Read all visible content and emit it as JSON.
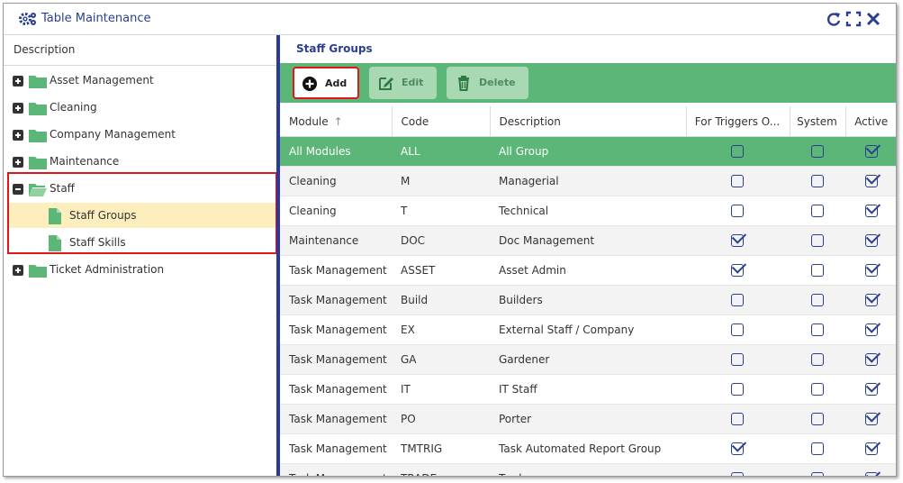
{
  "window": {
    "title": "Table Maintenance"
  },
  "tree": {
    "header": "Description",
    "items": [
      {
        "label": "Asset Management",
        "expanded": false
      },
      {
        "label": "Cleaning",
        "expanded": false
      },
      {
        "label": "Company Management",
        "expanded": false
      },
      {
        "label": "Maintenance",
        "expanded": false
      },
      {
        "label": "Staff",
        "expanded": true
      },
      {
        "label": "Staff Groups",
        "selected": true
      },
      {
        "label": "Staff Skills"
      },
      {
        "label": "Ticket Administration",
        "expanded": false
      }
    ]
  },
  "main": {
    "title": "Staff Groups",
    "toolbar": {
      "add": "Add",
      "edit": "Edit",
      "delete": "Delete"
    },
    "columns": [
      "Module",
      "Code",
      "Description",
      "For Triggers O...",
      "System",
      "Active"
    ],
    "rows": [
      {
        "module": "All Modules",
        "code": "ALL",
        "description": "All Group",
        "triggers": false,
        "system": false,
        "active": true
      },
      {
        "module": "Cleaning",
        "code": "M",
        "description": "Managerial",
        "triggers": false,
        "system": false,
        "active": true
      },
      {
        "module": "Cleaning",
        "code": "T",
        "description": "Technical",
        "triggers": false,
        "system": false,
        "active": true
      },
      {
        "module": "Maintenance",
        "code": "DOC",
        "description": "Doc Management",
        "triggers": true,
        "system": false,
        "active": true
      },
      {
        "module": "Task Management",
        "code": "ASSET",
        "description": "Asset Admin",
        "triggers": true,
        "system": false,
        "active": true
      },
      {
        "module": "Task Management",
        "code": "Build",
        "description": "Builders",
        "triggers": false,
        "system": false,
        "active": true
      },
      {
        "module": "Task Management",
        "code": "EX",
        "description": "External Staff / Company",
        "triggers": false,
        "system": false,
        "active": true
      },
      {
        "module": "Task Management",
        "code": "GA",
        "description": "Gardener",
        "triggers": false,
        "system": false,
        "active": true
      },
      {
        "module": "Task Management",
        "code": "IT",
        "description": "IT Staff",
        "triggers": false,
        "system": false,
        "active": true
      },
      {
        "module": "Task Management",
        "code": "PO",
        "description": "Porter",
        "triggers": false,
        "system": false,
        "active": true
      },
      {
        "module": "Task Management",
        "code": "TMTRIG",
        "description": "Task Automated Report Group",
        "triggers": true,
        "system": false,
        "active": true
      },
      {
        "module": "Task Management",
        "code": "TRADE",
        "description": "Tradesman",
        "triggers": false,
        "system": false,
        "active": true
      }
    ]
  },
  "colors": {
    "accent": "#2a3f8f",
    "green": "#5cb678",
    "highlight": "#fcefbd",
    "red": "#e0161b",
    "folder": "#5cb678"
  }
}
